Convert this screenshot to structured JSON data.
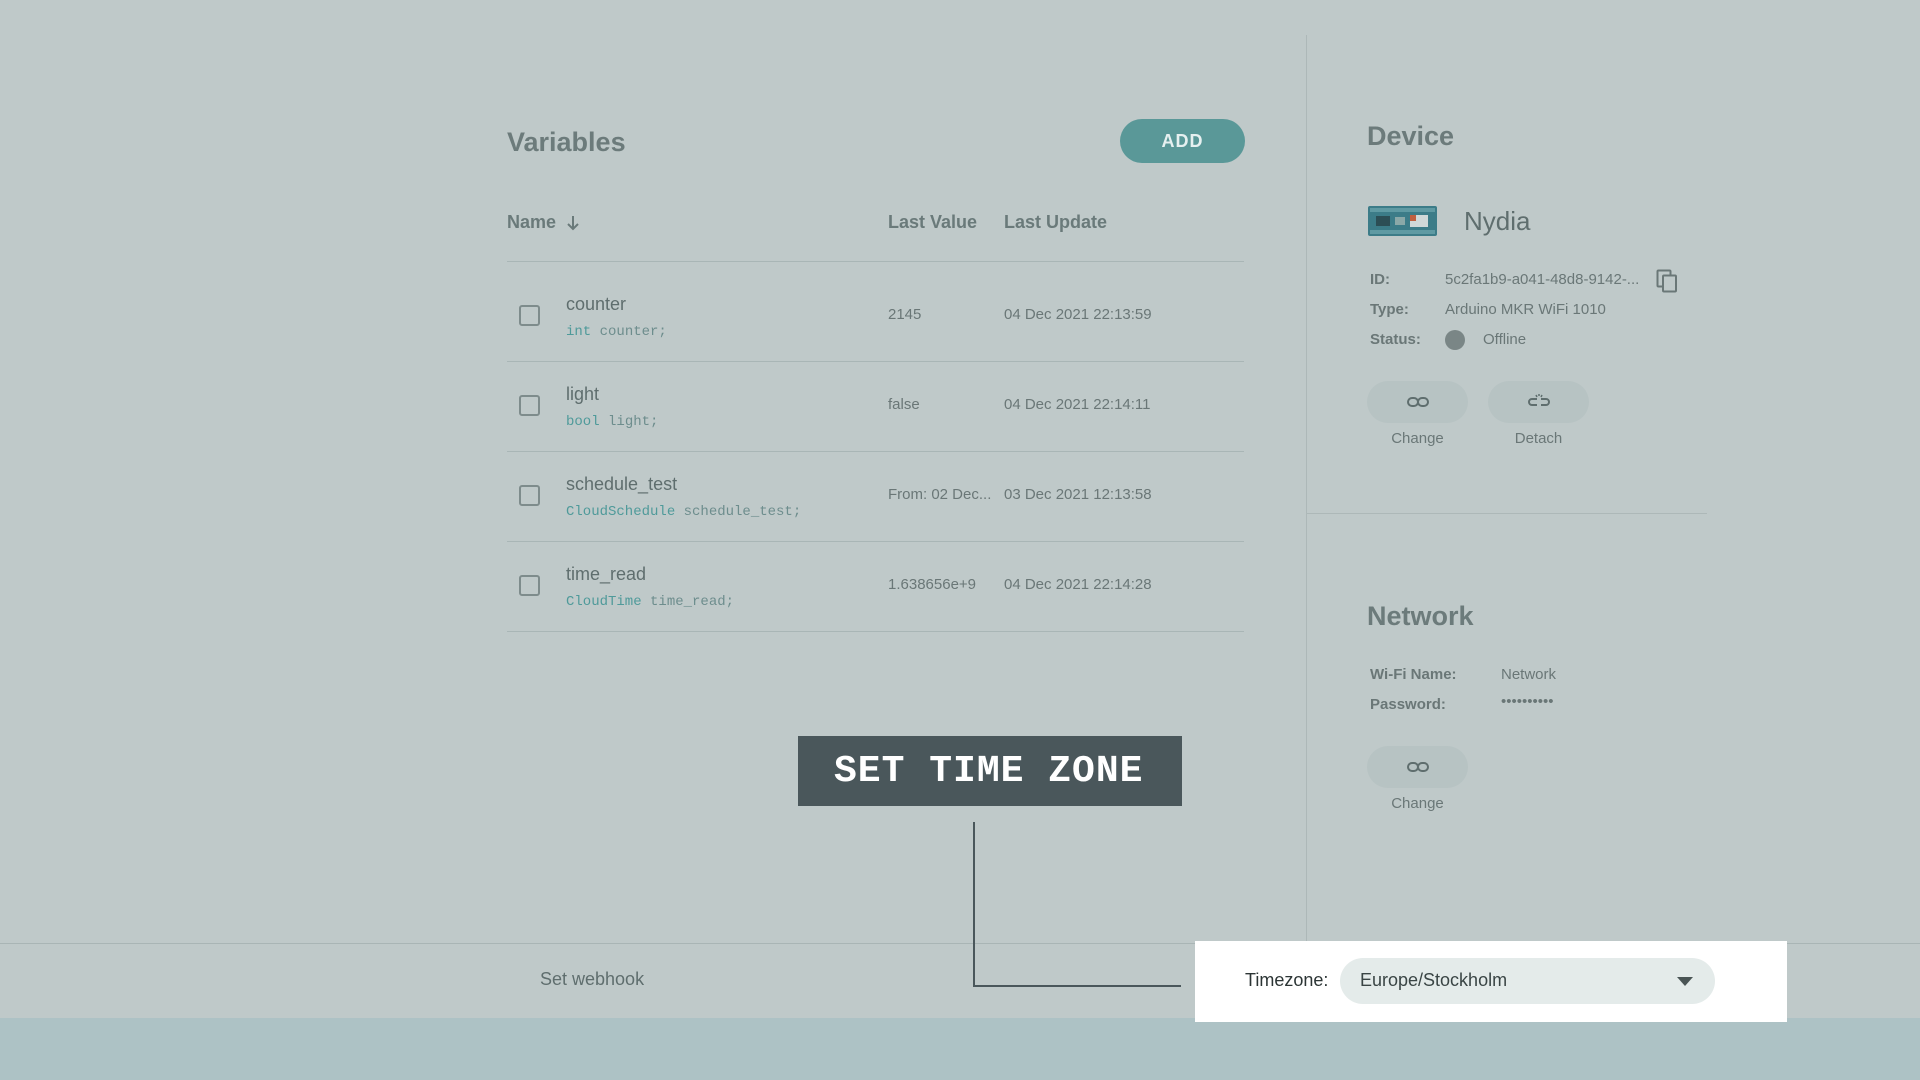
{
  "variables": {
    "title": "Variables",
    "add_label": "ADD",
    "columns": {
      "name": "Name",
      "last_value": "Last Value",
      "last_update": "Last Update"
    },
    "rows": [
      {
        "name": "counter",
        "decl_type": "int",
        "decl_rest": " counter;",
        "value": "2145",
        "updated": "04 Dec 2021 22:13:59"
      },
      {
        "name": "light",
        "decl_type": "bool",
        "decl_rest": " light;",
        "value": "false",
        "updated": "04 Dec 2021 22:14:11"
      },
      {
        "name": "schedule_test",
        "decl_type": "CloudSchedule",
        "decl_rest": " schedule_test;",
        "value": "From: 02 Dec...",
        "updated": "03 Dec 2021 12:13:58"
      },
      {
        "name": "time_read",
        "decl_type": "CloudTime",
        "decl_rest": " time_read;",
        "value": "1.638656e+9",
        "updated": "04 Dec 2021 22:14:28"
      }
    ]
  },
  "device": {
    "title": "Device",
    "name": "Nydia",
    "id_label": "ID:",
    "id_value": "5c2fa1b9-a041-48d8-9142-...",
    "type_label": "Type:",
    "type_value": "Arduino MKR WiFi 1010",
    "status_label": "Status:",
    "status_value": "Offline",
    "change_label": "Change",
    "detach_label": "Detach"
  },
  "network": {
    "title": "Network",
    "wifi_label": "Wi-Fi Name:",
    "wifi_value": "Network",
    "password_label": "Password:",
    "password_value": "••••••••••",
    "change_label": "Change"
  },
  "footer": {
    "webhook_label": "Set webhook",
    "timezone_label": "Timezone:",
    "timezone_value": "Europe/Stockholm"
  },
  "callout": {
    "text": "SET TIME ZONE"
  },
  "colors": {
    "accent": "#5a9898",
    "callout_bg": "#4a575b",
    "background": "#bfc9c9"
  }
}
